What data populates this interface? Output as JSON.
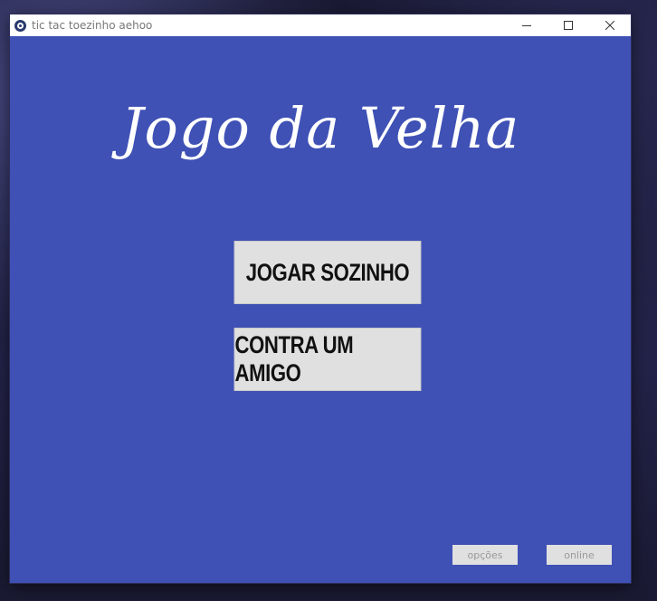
{
  "window": {
    "title": "tic tac toezinho aehoo",
    "controls": {
      "minimize": "—",
      "maximize": "☐",
      "close": "✕"
    }
  },
  "main": {
    "game_title": "Jogo da Velha",
    "buttons": {
      "solo": "JOGAR SOZINHO",
      "friend": "CONTRA UM AMIGO"
    },
    "footer": {
      "options": "opções",
      "online": "online"
    }
  },
  "colors": {
    "background": "#3f51b5",
    "button": "#e0e0e0",
    "title_text": "#ffffff"
  }
}
